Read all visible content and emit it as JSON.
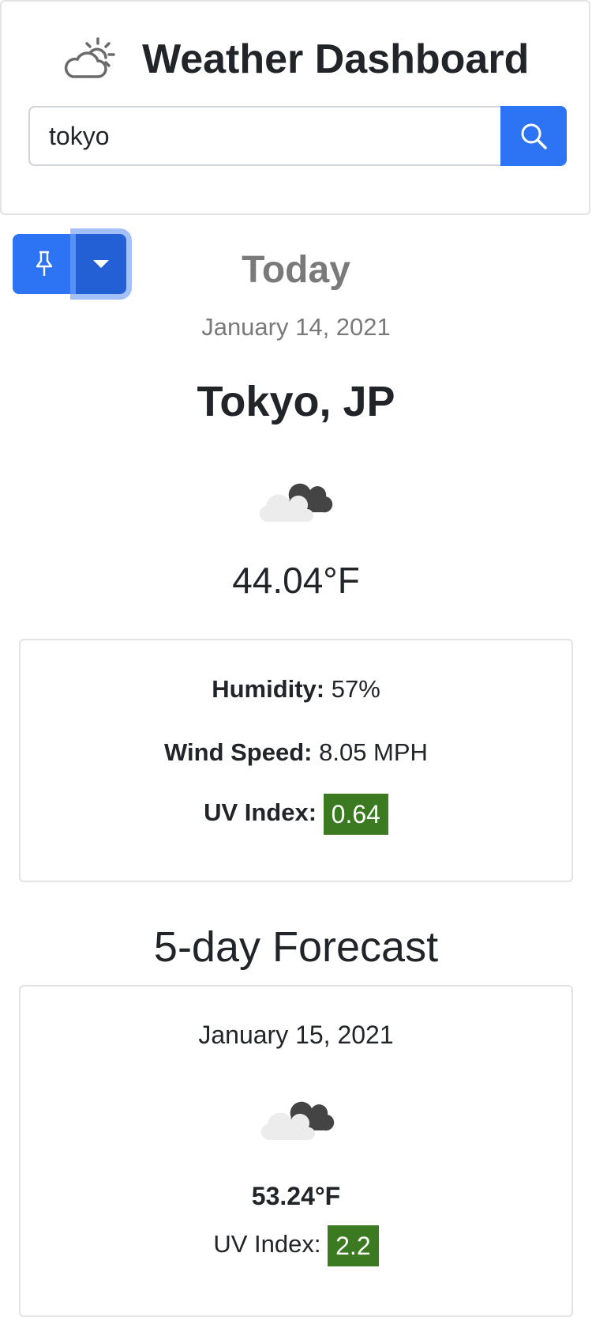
{
  "header": {
    "title": "Weather Dashboard",
    "logo_icon": "cloud-sun-icon"
  },
  "search": {
    "value": "tokyo",
    "button_icon": "search-icon"
  },
  "pin_menu": {
    "pin_icon": "pin-icon",
    "toggle_icon": "caret-down-icon"
  },
  "today": {
    "heading": "Today",
    "date": "January 14, 2021",
    "city": "Tokyo, JP",
    "icon": "broken-clouds-icon",
    "temperature": "44.04°F",
    "humidity_label": "Humidity:",
    "humidity_value": "57%",
    "wind_label": "Wind Speed:",
    "wind_value": "8.05 MPH",
    "uv_label": "UV Index:",
    "uv_value": "0.64",
    "uv_color": "#3b7a20"
  },
  "forecast": {
    "heading": "5-day Forecast",
    "days": [
      {
        "date": "January 15, 2021",
        "icon": "broken-clouds-icon",
        "temperature": "53.24°F",
        "uv_label": "UV Index:",
        "uv_value": "2.2",
        "uv_color": "#3b7a20"
      }
    ]
  },
  "colors": {
    "primary": "#2d74f5",
    "primary_dark": "#2360d6",
    "muted_text": "#7a7a7a",
    "text": "#212529",
    "border": "#e3e3e3"
  }
}
